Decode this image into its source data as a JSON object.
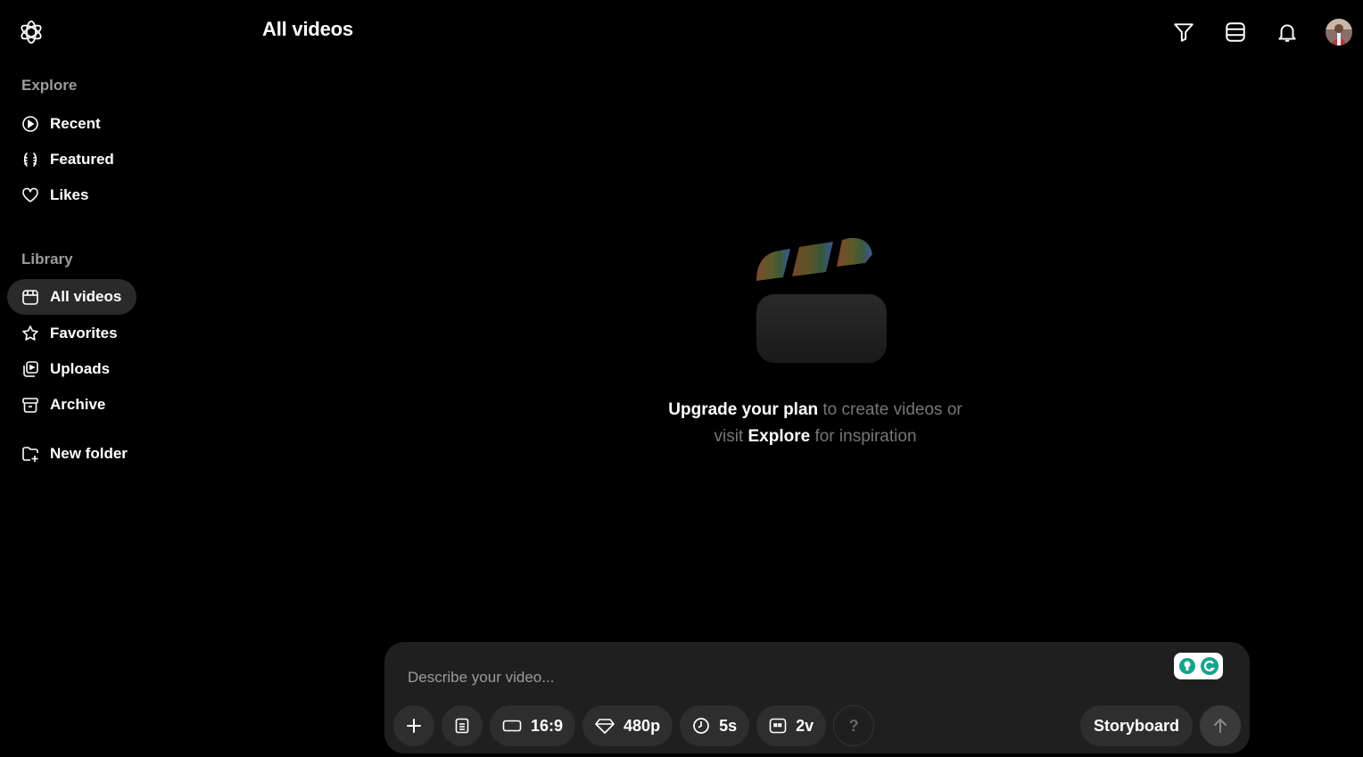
{
  "header": {
    "title": "All videos"
  },
  "sidebar": {
    "explore_label": "Explore",
    "explore_items": [
      {
        "label": "Recent",
        "icon": "play-circle-icon"
      },
      {
        "label": "Featured",
        "icon": "laurel-icon"
      },
      {
        "label": "Likes",
        "icon": "heart-icon"
      }
    ],
    "library_label": "Library",
    "library_items": [
      {
        "label": "All videos",
        "icon": "calendar-icon",
        "active": true
      },
      {
        "label": "Favorites",
        "icon": "star-icon"
      },
      {
        "label": "Uploads",
        "icon": "upload-stack-icon"
      },
      {
        "label": "Archive",
        "icon": "archive-icon"
      }
    ],
    "new_folder_label": "New folder"
  },
  "empty_state": {
    "highlight_1": "Upgrade your plan",
    "text_1": " to create videos or",
    "text_2": "visit ",
    "highlight_2": "Explore",
    "text_3": " for inspiration"
  },
  "composer": {
    "placeholder": "Describe your video...",
    "aspect_ratio": "16:9",
    "resolution": "480p",
    "duration": "5s",
    "variations": "2v",
    "help": "?",
    "storyboard_label": "Storyboard"
  },
  "colors": {
    "background": "#000000",
    "panel": "#1f1f1f",
    "pill": "#2e2e2e",
    "muted_text": "#767676",
    "active_nav": "#2a2a2a"
  }
}
